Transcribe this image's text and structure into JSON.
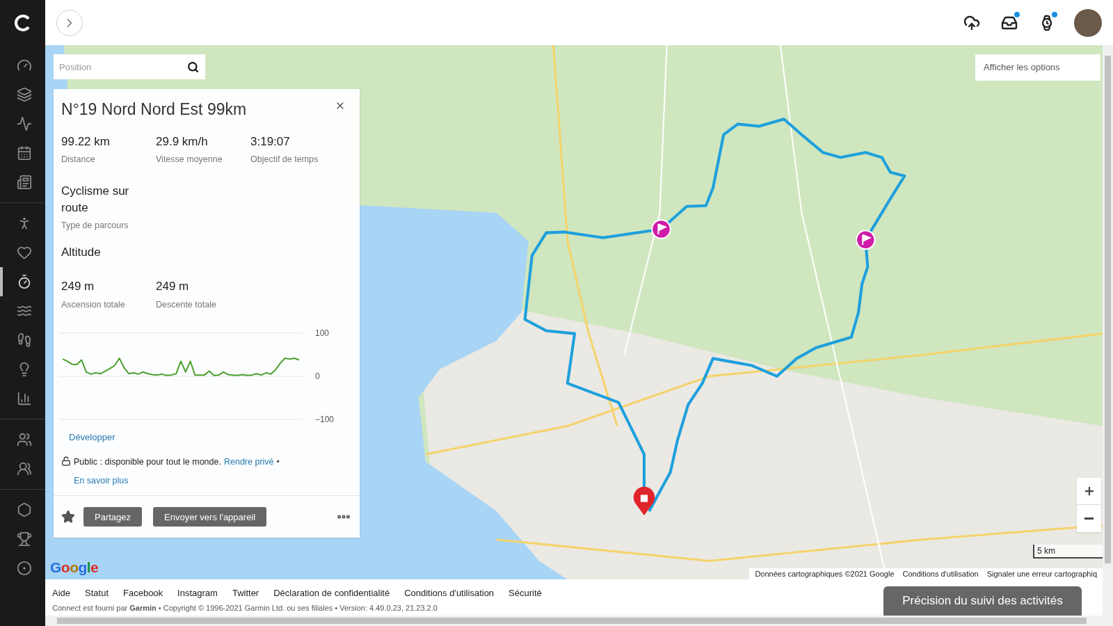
{
  "sidebar": {
    "groups": [
      [
        {
          "selected": false
        },
        {
          "selected": false
        },
        {
          "selected": false
        },
        {
          "selected": false
        },
        {
          "selected": false
        }
      ],
      [
        {
          "selected": false
        },
        {
          "selected": false
        },
        {
          "selected": true
        },
        {
          "selected": false
        },
        {
          "selected": false
        },
        {
          "selected": false
        },
        {
          "selected": false
        }
      ],
      [
        {
          "selected": false
        },
        {
          "selected": false
        }
      ],
      [
        {
          "selected": false
        },
        {
          "selected": false
        },
        {
          "selected": false
        }
      ]
    ]
  },
  "header": {
    "notifications": [
      {
        "kind": "upload",
        "notification": false
      },
      {
        "kind": "inbox",
        "notification": true
      },
      {
        "kind": "device",
        "notification": true
      }
    ]
  },
  "map": {
    "search": {
      "placeholder": "Position"
    },
    "options_button": "Afficher les options",
    "scale": "5 km",
    "attribution": [
      "Données cartographiques ©2021 Google",
      "Conditions d'utilisation",
      "Signaler une erreur cartographiq"
    ],
    "logo": "Google"
  },
  "course": {
    "title": "N°19 Nord Nord Est 99km",
    "stats": [
      {
        "value": "99.22 km",
        "label": "Distance"
      },
      {
        "value": "29.9 km/h",
        "label": "Vitesse moyenne"
      },
      {
        "value": "3:19:07",
        "label": "Objectif de temps"
      }
    ],
    "course_type": {
      "value": "Cyclisme sur route",
      "label": "Type de parcours"
    },
    "altitude_title": "Altitude",
    "altitude_stats": [
      {
        "value": "249 m",
        "label": "Ascension totale"
      },
      {
        "value": "249 m",
        "label": "Descente totale"
      }
    ],
    "chart_data": {
      "type": "line",
      "ylim": [
        -100,
        100
      ],
      "yticks": [
        {
          "value": 100,
          "label": "100"
        },
        {
          "value": 0,
          "label": "0"
        },
        {
          "value": -100,
          "label": "−100"
        }
      ],
      "series": [
        {
          "color": "#4aa02c",
          "values": [
            40,
            35,
            28,
            27,
            38,
            10,
            5,
            8,
            6,
            12,
            18,
            25,
            42,
            20,
            6,
            8,
            5,
            10,
            6,
            4,
            3,
            5,
            2,
            3,
            6,
            35,
            10,
            35,
            3,
            3,
            3,
            12,
            2,
            3,
            10,
            4,
            3,
            2,
            4,
            2,
            3,
            6,
            3,
            8,
            5,
            15,
            30,
            42,
            40,
            42,
            38
          ]
        }
      ]
    },
    "expand_link": "Développer",
    "privacy": {
      "text": "Public : disponible pour tout le monde.",
      "link": "Rendre privé",
      "separator": "•",
      "learn_more": "En savoir plus"
    },
    "favorite": false,
    "buttons": [
      "Partagez",
      "Envoyer vers l'appareil"
    ]
  },
  "footer": {
    "links": [
      "Aide",
      "Statut",
      "Facebook",
      "Instagram",
      "Twitter",
      "Déclaration de confidentialité",
      "Conditions d'utilisation",
      "Sécurité"
    ],
    "copyright": "Connect est fourni par **Garmin** • Copyright © 1996-2021 Garmin Ltd. ou ses filiales • Version: 4.49.0.23, 21.23.2.0",
    "feedback_button": "Précision du suivi des activités"
  }
}
